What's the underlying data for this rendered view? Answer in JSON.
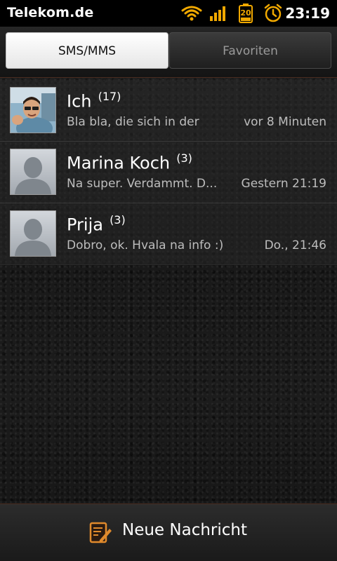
{
  "status_bar": {
    "carrier": "Telekom.de",
    "time": "23:19",
    "battery_level": "20",
    "icons": [
      "wifi-icon",
      "signal-icon",
      "battery-icon",
      "alarm-icon"
    ],
    "accent_color": "#f0a800"
  },
  "tabs": [
    {
      "label": "SMS/MMS",
      "selected": true
    },
    {
      "label": "Favoriten",
      "selected": false
    }
  ],
  "conversations": [
    {
      "name": "Ich",
      "count": "(17)",
      "snippet": "Bla bla, die sich in der",
      "time": "vor 8 Minuten",
      "avatar": "photo"
    },
    {
      "name": "Marina Koch",
      "count": "(3)",
      "snippet": "Na super. Verdammt. D...",
      "time": "Gestern 21:19",
      "avatar": "placeholder"
    },
    {
      "name": "Prija",
      "count": "(3)",
      "snippet": "Dobro, ok. Hvala na info :)",
      "time": "Do., 21:46",
      "avatar": "placeholder"
    }
  ],
  "bottom_bar": {
    "new_message_label": "Neue Nachricht",
    "icon": "compose-icon",
    "icon_color": "#e08a2c"
  }
}
